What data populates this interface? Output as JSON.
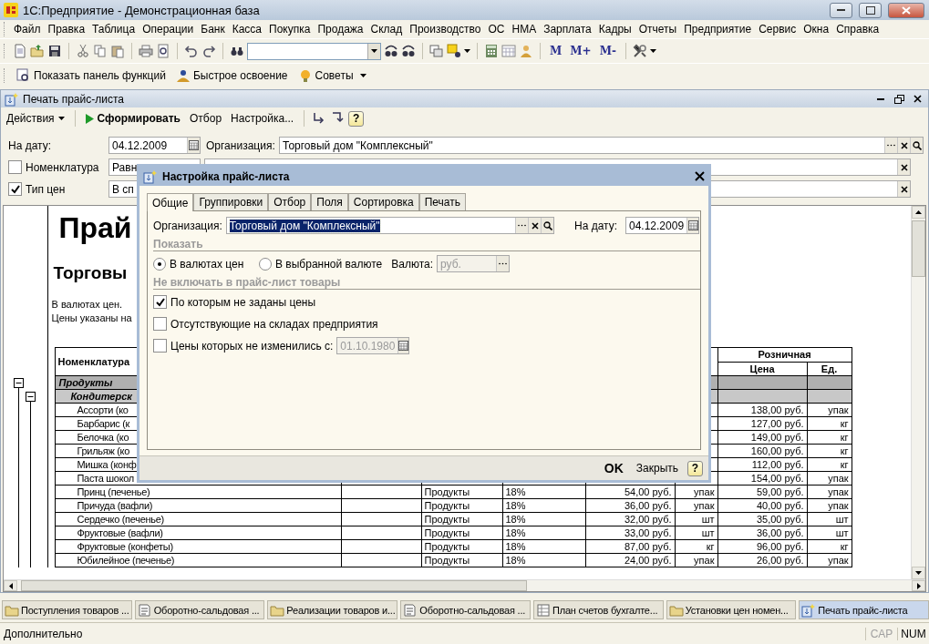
{
  "window": {
    "title": "1С:Предприятие - Демонстрационная база"
  },
  "menu": [
    "Файл",
    "Правка",
    "Таблица",
    "Операции",
    "Банк",
    "Касса",
    "Покупка",
    "Продажа",
    "Склад",
    "Производство",
    "ОС",
    "НМА",
    "Зарплата",
    "Кадры",
    "Отчеты",
    "Предприятие",
    "Сервис",
    "Окна",
    "Справка"
  ],
  "memory_buttons": [
    "M",
    "M+",
    "M-"
  ],
  "panel_toolbar": [
    {
      "label": "Показать панель функций",
      "kind": "functions"
    },
    {
      "label": "Быстрое освоение",
      "kind": "learn"
    },
    {
      "label": "Советы",
      "kind": "tips"
    }
  ],
  "document": {
    "title": "Печать прайс-листа",
    "actions": [
      {
        "label": "Действия",
        "kind": "menu"
      },
      {
        "label": "Сформировать",
        "kind": "run"
      },
      {
        "label": "Отбор",
        "kind": "plain"
      },
      {
        "label": "Настройка...",
        "kind": "plain"
      }
    ],
    "help": "?",
    "date_label": "На дату:",
    "date": "04.12.2009",
    "org_label": "Организация:",
    "org": "Торговый дом \"Комплексный\"",
    "filters": [
      {
        "label": "Номенклатура",
        "checked": false,
        "condition": "Равн"
      },
      {
        "label": "Тип цен",
        "checked": true,
        "condition": "В сп"
      }
    ]
  },
  "report": {
    "title": "Прай",
    "org": "Торговы",
    "notes": [
      "В валютах цен.",
      "Цены указаны на"
    ],
    "name_header": "Номенклатура",
    "retail_header": "Розничная",
    "price_header": "Цена",
    "unit_header": "Ед.",
    "tree": [
      {
        "name": "Продукты",
        "expanded": true,
        "children": [
          {
            "name": "Кондитерск",
            "expanded": true,
            "children": [
              {
                "name": "Ассорти (ко",
                "retail": "138,00 руб.",
                "retail_unit": "упак"
              },
              {
                "name": "Барбарис (к",
                "retail": "127,00 руб.",
                "retail_unit": "кг"
              },
              {
                "name": "Белочка (ко",
                "retail": "149,00 руб.",
                "retail_unit": "кг"
              },
              {
                "name": "Грильяж (ко",
                "retail": "160,00 руб.",
                "retail_unit": "кг"
              },
              {
                "name": "Мишка (конф",
                "retail": "112,00 руб.",
                "retail_unit": "кг"
              },
              {
                "name": "Паста шокол",
                "retail": "154,00 руб.",
                "retail_unit": "упак"
              },
              {
                "name": "Принц (печенье)",
                "category": "Продукты",
                "vat": "18%",
                "price": "54,00 руб.",
                "unit": "упак",
                "retail": "59,00 руб.",
                "retail_unit": "упак"
              },
              {
                "name": "Причуда (вафли)",
                "category": "Продукты",
                "vat": "18%",
                "price": "36,00 руб.",
                "unit": "упак",
                "retail": "40,00 руб.",
                "retail_unit": "упак"
              },
              {
                "name": "Сердечко (печенье)",
                "category": "Продукты",
                "vat": "18%",
                "price": "32,00 руб.",
                "unit": "шт",
                "retail": "35,00 руб.",
                "retail_unit": "шт"
              },
              {
                "name": "Фруктовые (вафли)",
                "category": "Продукты",
                "vat": "18%",
                "price": "33,00 руб.",
                "unit": "шт",
                "retail": "36,00 руб.",
                "retail_unit": "шт"
              },
              {
                "name": "Фруктовые (конфеты)",
                "category": "Продукты",
                "vat": "18%",
                "price": "87,00 руб.",
                "unit": "кг",
                "retail": "96,00 руб.",
                "retail_unit": "кг"
              },
              {
                "name": "Юбилейное (печенье)",
                "category": "Продукты",
                "vat": "18%",
                "price": "24,00 руб.",
                "unit": "упак",
                "retail": "26,00 руб.",
                "retail_unit": "упак"
              }
            ]
          }
        ]
      }
    ]
  },
  "dialog": {
    "title": "Настройка прайс-листа",
    "tabs": [
      {
        "label": "Общие",
        "selected": true
      },
      {
        "label": "Группировки",
        "selected": false
      },
      {
        "label": "Отбор",
        "selected": false
      },
      {
        "label": "Поля",
        "selected": false
      },
      {
        "label": "Сортировка",
        "selected": false
      },
      {
        "label": "Печать",
        "selected": false
      }
    ],
    "org_label": "Организация:",
    "org": "Торговый дом \"Комплексный\"",
    "org_highlighted": true,
    "date_label": "На дату:",
    "date": "04.12.2009",
    "show_section": "Показать",
    "radios": [
      {
        "label": "В валютах цен",
        "selected": true
      },
      {
        "label": "В выбранной валюте",
        "selected": false
      }
    ],
    "currency_label": "Валюта:",
    "currency": "руб.",
    "exclude_section": "Не включать в прайс-лист товары",
    "options": [
      {
        "label": "По которым не заданы цены",
        "checked": true
      },
      {
        "label": "Отсутствующие на складах предприятия",
        "checked": false
      },
      {
        "label": "Цены которых не изменились с:",
        "checked": false,
        "date": "01.10.1980"
      }
    ],
    "buttons": [
      {
        "label": "OK",
        "kind": "default"
      },
      {
        "label": "Закрыть",
        "kind": "plain"
      },
      {
        "label": "?",
        "kind": "help"
      }
    ]
  },
  "windows": [
    {
      "label": "Поступления товаров ...",
      "kind": "journal",
      "selected": false
    },
    {
      "label": "Оборотно-сальдовая ...",
      "kind": "report",
      "selected": false
    },
    {
      "label": "Реализации товаров и...",
      "kind": "journal",
      "selected": false
    },
    {
      "label": "Оборотно-сальдовая ...",
      "kind": "report",
      "selected": false
    },
    {
      "label": "План счетов бухгалте...",
      "kind": "list",
      "selected": false
    },
    {
      "label": "Установки цен номен...",
      "kind": "journal",
      "selected": false
    },
    {
      "label": "Печать прайс-листа",
      "kind": "form",
      "selected": true
    }
  ],
  "status": {
    "text": "Дополнительно",
    "indicators": [
      {
        "label": "CAP",
        "on": false
      },
      {
        "label": "NUM",
        "on": true
      }
    ]
  }
}
